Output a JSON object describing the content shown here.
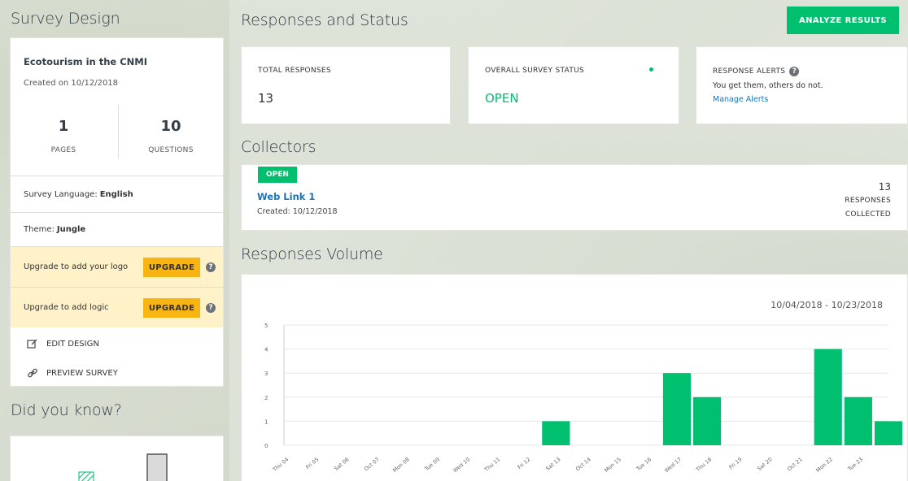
{
  "left": {
    "section_title": "Survey Design",
    "survey_title": "Ecotourism in the CNMI",
    "created": "Created on 10/12/2018",
    "pages_count": "1",
    "pages_label": "PAGES",
    "questions_count": "10",
    "questions_label": "QUESTIONS",
    "language_label": "Survey Language: ",
    "language_value": "English",
    "theme_label": "Theme: ",
    "theme_value": "Jungle",
    "upgrade_logo_text": "Upgrade to add your logo",
    "upgrade_logic_text": "Upgrade to add logic",
    "upgrade_label": "UPGRADE",
    "help_glyph": "?",
    "edit_design": "EDIT DESIGN",
    "preview_survey": "PREVIEW SURVEY",
    "did_you_know": "Did you know?"
  },
  "main": {
    "section_title": "Responses and Status",
    "analyze_button": "ANALYZE RESULTS",
    "total_responses_label": "TOTAL RESPONSES",
    "total_responses_value": "13",
    "status_label": "OVERALL SURVEY STATUS",
    "status_value": "OPEN",
    "alerts_label": "RESPONSE ALERTS",
    "alerts_text": "You get them, others do not.",
    "alerts_link": "Manage Alerts"
  },
  "collectors": {
    "section_title": "Collectors",
    "badge": "OPEN",
    "name": "Web Link 1",
    "created": "Created: 10/12/2018",
    "count": "13",
    "count_label_1": "RESPONSES",
    "count_label_2": "COLLECTED"
  },
  "volume": {
    "section_title": "Responses Volume",
    "date_range": "10/04/2018 - 10/23/2018"
  },
  "colors": {
    "accent_green": "#00bf6f",
    "upgrade_yellow": "#f8b413",
    "link_blue": "#1a73b8"
  },
  "chart_data": {
    "type": "bar",
    "categories": [
      "Thu 04",
      "Fri 05",
      "Sat 06",
      "Oct 07",
      "Mon 08",
      "Tue 09",
      "Wed 10",
      "Thu 11",
      "Fri 12",
      "Sat 13",
      "Oct 14",
      "Mon 15",
      "Tue 16",
      "Wed 17",
      "Thu 18",
      "Fri 19",
      "Sat 20",
      "Oct 21",
      "Mon 22",
      "Tue 23"
    ],
    "values": [
      0,
      0,
      0,
      0,
      0,
      0,
      0,
      0,
      0,
      1,
      0,
      0,
      0,
      3,
      2,
      0,
      0,
      0,
      4,
      2,
      1
    ],
    "ylim": [
      0,
      5
    ],
    "yticks": [
      0,
      1,
      2,
      3,
      4,
      5
    ],
    "color": "#00bf6f",
    "grid": true
  }
}
